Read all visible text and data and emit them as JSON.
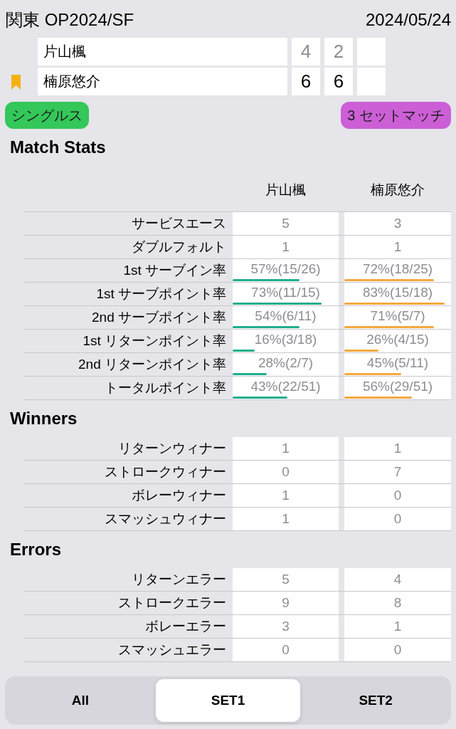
{
  "header": {
    "title": "関東 OP2024/SF",
    "date": "2024/05/24"
  },
  "scoreboard": {
    "players": [
      {
        "name": "片山楓",
        "winner": false,
        "sets": [
          "4",
          "2"
        ]
      },
      {
        "name": "楠原悠介",
        "winner": true,
        "sets": [
          "6",
          "6"
        ]
      }
    ]
  },
  "tags": [
    {
      "label": "シングルス",
      "color": "#34c759"
    },
    {
      "label": "3 セットマッチ",
      "color": "#cc5fd6"
    }
  ],
  "sections": [
    {
      "title": "Match Stats",
      "players": [
        {
          "name": "片山楓",
          "color": "#1fae8e"
        },
        {
          "name": "楠原悠介",
          "color": "#f5a83f"
        }
      ],
      "rows": [
        {
          "label": "サービスエース",
          "kind": "count",
          "values": [
            {
              "text": "5"
            },
            {
              "text": "3"
            }
          ]
        },
        {
          "label": "ダブルフォルト",
          "kind": "count",
          "values": [
            {
              "text": "1"
            },
            {
              "text": "1"
            }
          ]
        },
        {
          "label": "1st サーブイン率",
          "kind": "rate",
          "values": [
            {
              "text": "57%(15/26)",
              "level": 0.63
            },
            {
              "text": "72%(18/25)",
              "level": 0.84
            }
          ]
        },
        {
          "label": "1st サーブポイント率",
          "kind": "rate",
          "values": [
            {
              "text": "73%(11/15)",
              "level": 0.84
            },
            {
              "text": "83%(15/18)",
              "level": 0.94
            }
          ]
        },
        {
          "label": "2nd サーブポイント率",
          "kind": "rate",
          "values": [
            {
              "text": "54%(6/11)",
              "level": 0.63
            },
            {
              "text": "71%(5/7)",
              "level": 0.84
            }
          ]
        },
        {
          "label": "1st リターンポイント率",
          "kind": "rate",
          "values": [
            {
              "text": "16%(3/18)",
              "level": 0.21
            },
            {
              "text": "26%(4/15)",
              "level": 0.32
            }
          ]
        },
        {
          "label": "2nd リターンポイント率",
          "kind": "rate",
          "values": [
            {
              "text": "28%(2/7)",
              "level": 0.32
            },
            {
              "text": "45%(5/11)",
              "level": 0.53
            }
          ]
        },
        {
          "label": "トータルポイント率",
          "kind": "rate",
          "values": [
            {
              "text": "43%(22/51)",
              "level": 0.52
            },
            {
              "text": "56%(29/51)",
              "level": 0.63
            }
          ]
        }
      ]
    },
    {
      "title": "Winners",
      "rows": [
        {
          "label": "リターンウィナー",
          "kind": "count",
          "values": [
            {
              "text": "1"
            },
            {
              "text": "1"
            }
          ]
        },
        {
          "label": "ストロークウィナー",
          "kind": "count",
          "values": [
            {
              "text": "0"
            },
            {
              "text": "7"
            }
          ]
        },
        {
          "label": "ボレーウィナー",
          "kind": "count",
          "values": [
            {
              "text": "1"
            },
            {
              "text": "0"
            }
          ]
        },
        {
          "label": "スマッシュウィナー",
          "kind": "count",
          "values": [
            {
              "text": "1"
            },
            {
              "text": "0"
            }
          ]
        }
      ]
    },
    {
      "title": "Errors",
      "rows": [
        {
          "label": "リターンエラー",
          "kind": "count",
          "values": [
            {
              "text": "5"
            },
            {
              "text": "4"
            }
          ]
        },
        {
          "label": "ストロークエラー",
          "kind": "count",
          "values": [
            {
              "text": "9"
            },
            {
              "text": "8"
            }
          ]
        },
        {
          "label": "ボレーエラー",
          "kind": "count",
          "values": [
            {
              "text": "3"
            },
            {
              "text": "1"
            }
          ]
        },
        {
          "label": "スマッシュエラー",
          "kind": "count",
          "values": [
            {
              "text": "0"
            },
            {
              "text": "0"
            }
          ]
        }
      ]
    }
  ],
  "set_tabs": [
    {
      "label": "All",
      "selected": false
    },
    {
      "label": "SET1",
      "selected": true
    },
    {
      "label": "SET2",
      "selected": false
    }
  ]
}
